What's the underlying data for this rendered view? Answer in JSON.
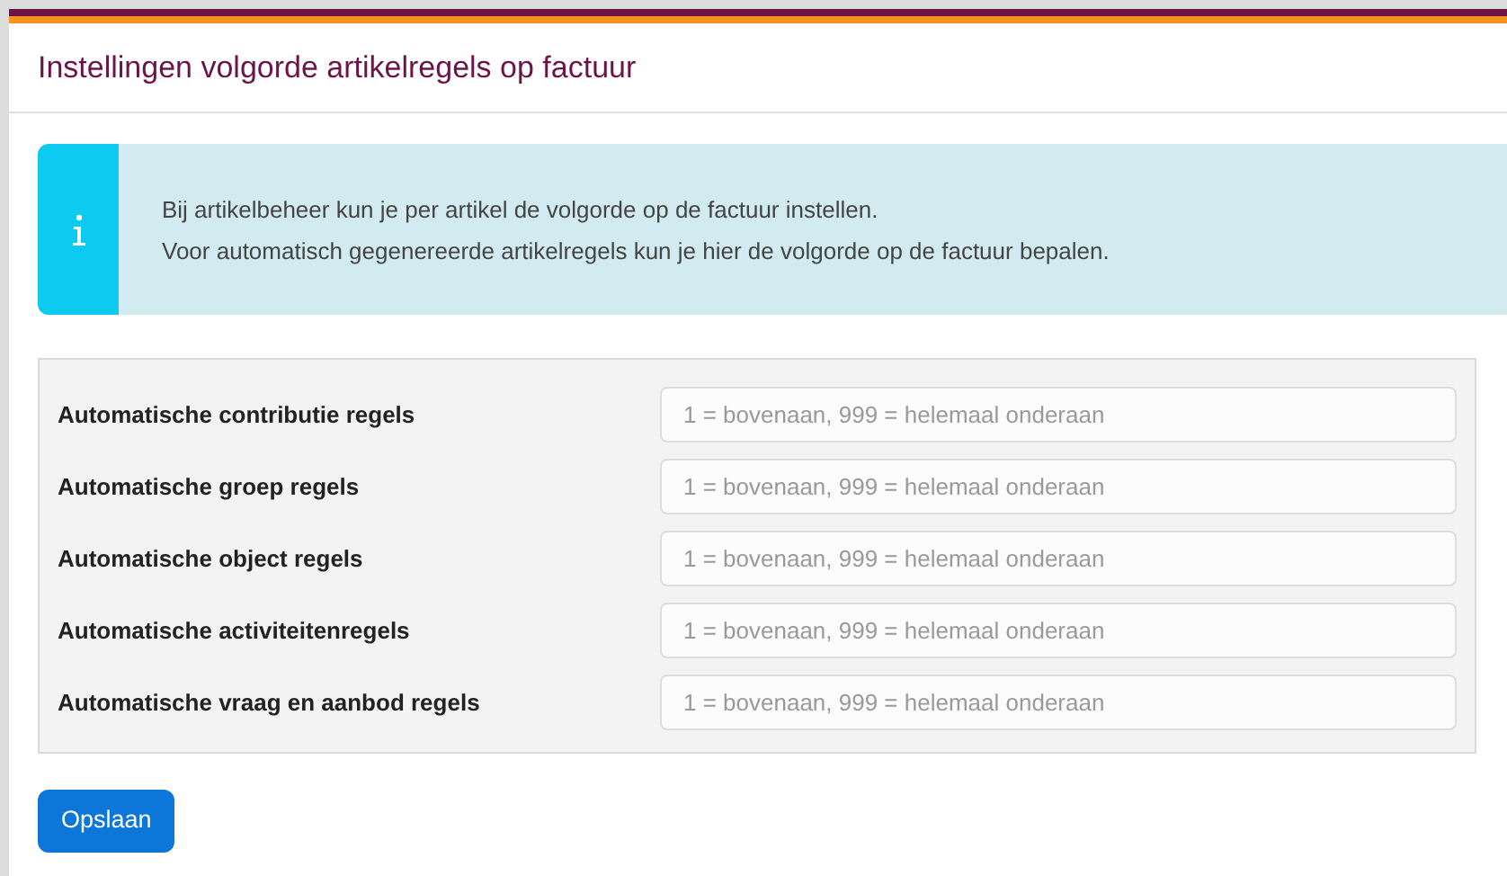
{
  "title": "Instellingen volgorde artikelregels op factuur",
  "info": {
    "lines": [
      "Bij artikelbeheer kun je per artikel de volgorde op de factuur instellen.",
      "Voor automatisch gegenereerde artikelregels kun je hier de volgorde op de factuur bepalen."
    ]
  },
  "fields": [
    {
      "label": "Automatische contributie regels",
      "placeholder": "1 = bovenaan, 999 = helemaal onderaan"
    },
    {
      "label": "Automatische groep regels",
      "placeholder": "1 = bovenaan, 999 = helemaal onderaan"
    },
    {
      "label": "Automatische object regels",
      "placeholder": "1 = bovenaan, 999 = helemaal onderaan"
    },
    {
      "label": "Automatische activiteitenregels",
      "placeholder": "1 = bovenaan, 999 = helemaal onderaan"
    },
    {
      "label": "Automatische vraag en aanbod regels",
      "placeholder": "1 = bovenaan, 999 = helemaal onderaan"
    }
  ],
  "buttons": [
    "Opslaan"
  ]
}
